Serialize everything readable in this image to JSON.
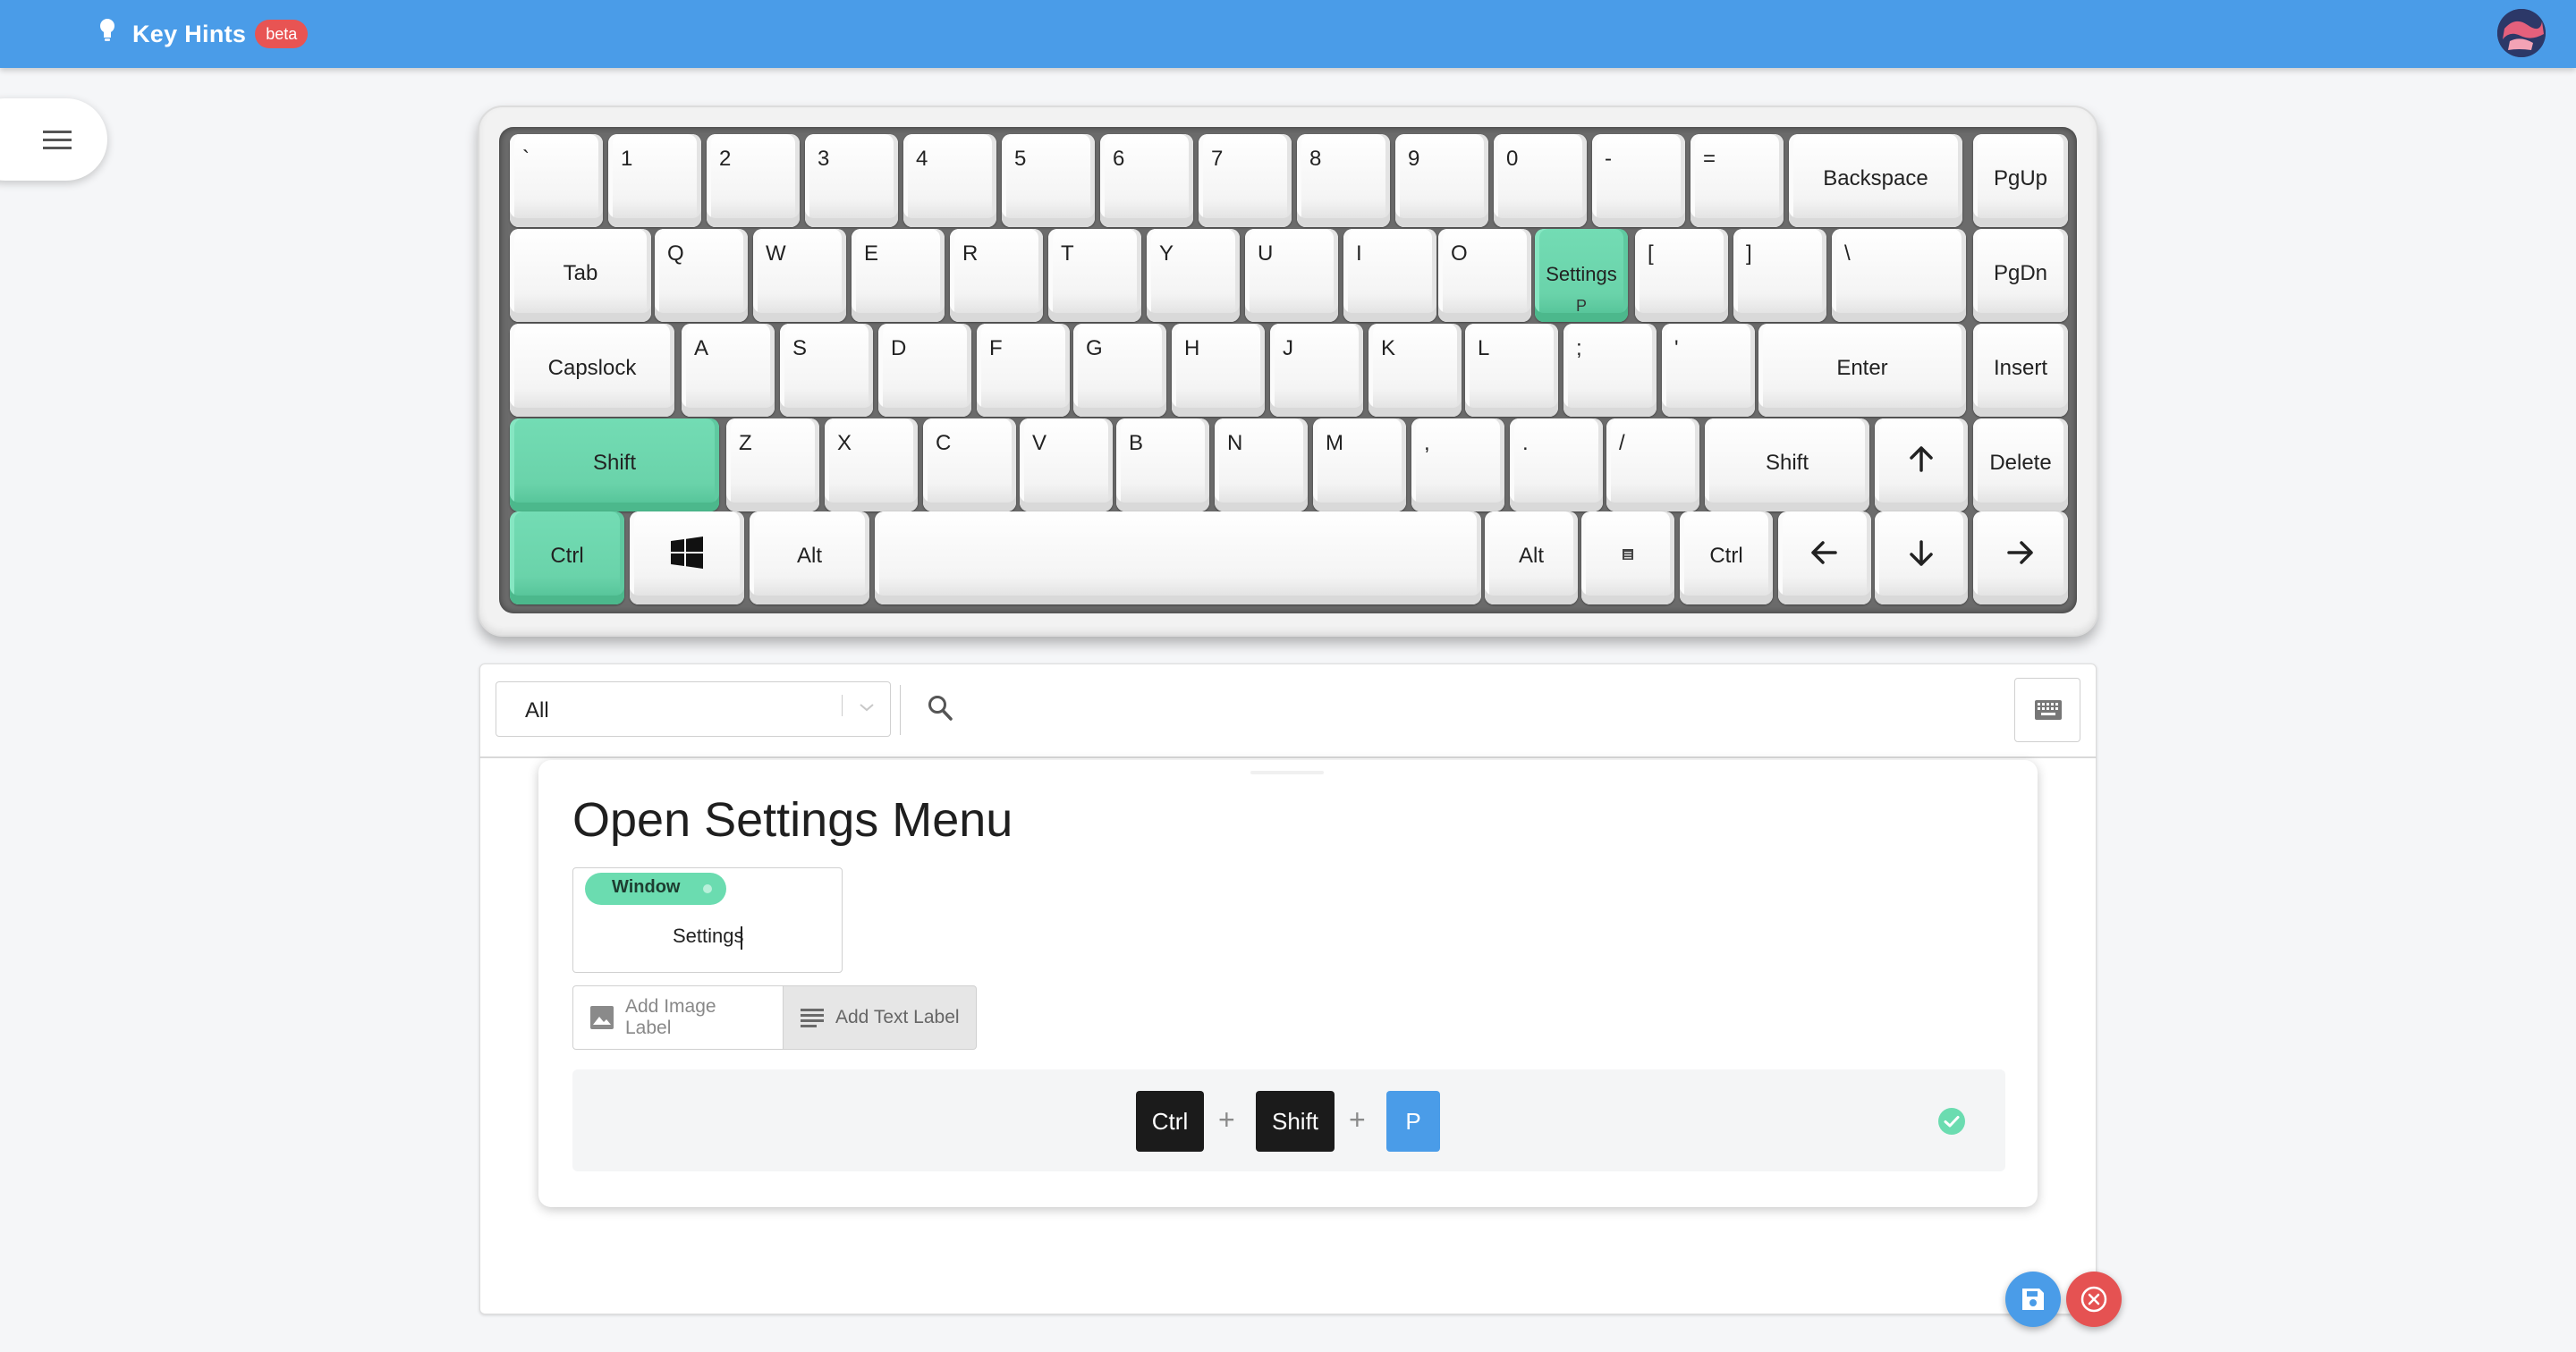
{
  "app": {
    "title": "Key Hints",
    "badge": "beta",
    "accent_color": "#4a9ce8",
    "highlight_color": "#6ad3aa"
  },
  "keyboard": {
    "row1": [
      "`",
      "1",
      "2",
      "3",
      "4",
      "5",
      "6",
      "7",
      "8",
      "9",
      "0",
      "-",
      "=",
      "Backspace",
      "PgUp"
    ],
    "row2": [
      "Tab",
      "Q",
      "W",
      "E",
      "R",
      "T",
      "Y",
      "U",
      "I",
      "O",
      "Settings",
      "P",
      "[",
      "]",
      "\\",
      "PgDn"
    ],
    "row3": [
      "Capslock",
      "A",
      "S",
      "D",
      "F",
      "G",
      "H",
      "J",
      "K",
      "L",
      ";",
      "'",
      "Enter",
      "Insert"
    ],
    "row4": [
      "Shift",
      "Z",
      "X",
      "C",
      "V",
      "B",
      "N",
      "M",
      ",",
      ".",
      "/",
      "Shift",
      "arrow-up-icon",
      "Delete"
    ],
    "row5": [
      "Ctrl",
      "windows-icon",
      "Alt",
      "Alt",
      "menu-key-icon",
      "Ctrl",
      "arrow-left-icon",
      "arrow-down-icon",
      "arrow-right-icon"
    ],
    "highlighted": [
      "Shift",
      "Ctrl",
      "Settings"
    ]
  },
  "filter": {
    "selected": "All",
    "search_placeholder": ""
  },
  "card": {
    "title": "Open Settings Menu",
    "chip": "Window",
    "label_value": "Settings",
    "add_image_label": "Add Image Label",
    "add_text_label": "Add Text Label",
    "shortcut": [
      "Ctrl",
      "Shift",
      "P"
    ],
    "plus": "+"
  }
}
